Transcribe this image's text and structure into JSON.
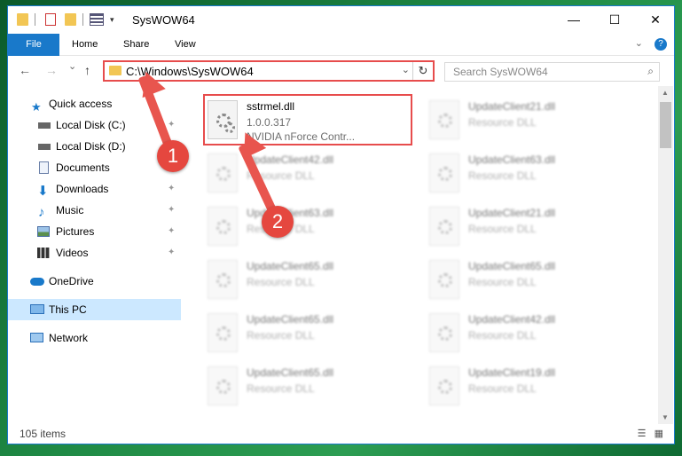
{
  "window": {
    "title": "SysWOW64",
    "minimize_glyph": "—",
    "maximize_glyph": "☐",
    "close_glyph": "✕"
  },
  "ribbon": {
    "tabs": [
      {
        "label": "File"
      },
      {
        "label": "Home"
      },
      {
        "label": "Share"
      },
      {
        "label": "View"
      }
    ],
    "help_glyph": "?"
  },
  "nav": {
    "back_glyph": "←",
    "forward_glyph": "→",
    "recent_glyph": "⌄",
    "up_glyph": "↑",
    "address": "C:\\Windows\\SysWOW64",
    "refresh_glyph": "↻",
    "search_placeholder": "Search SysWOW64"
  },
  "sidebar": {
    "items": [
      {
        "label": "Quick access",
        "icon": "star-icon",
        "pinned": false
      },
      {
        "label": "Local Disk (C:)",
        "icon": "drive-icon",
        "pinned": true
      },
      {
        "label": "Local Disk (D:)",
        "icon": "drive-icon",
        "pinned": false
      },
      {
        "label": "Documents",
        "icon": "document-icon",
        "pinned": true
      },
      {
        "label": "Downloads",
        "icon": "download-icon",
        "pinned": true
      },
      {
        "label": "Music",
        "icon": "music-icon",
        "pinned": true
      },
      {
        "label": "Pictures",
        "icon": "picture-icon",
        "pinned": true
      },
      {
        "label": "Videos",
        "icon": "video-icon",
        "pinned": true
      },
      {
        "label": "OneDrive",
        "icon": "cloud-icon",
        "pinned": false
      },
      {
        "label": "This PC",
        "icon": "computer-icon",
        "pinned": false,
        "selected": true
      },
      {
        "label": "Network",
        "icon": "network-icon",
        "pinned": false
      }
    ],
    "pin_glyph": "📌"
  },
  "files": [
    {
      "name": "sstrmel.dll",
      "line2": "1.0.0.317",
      "line3": "NVIDIA nForce Contr...",
      "highlighted": true
    },
    {
      "name": "UpdateClient21.dll",
      "line2": "Resource DLL"
    },
    {
      "name": "UpdateClient42.dll",
      "line2": "Resource DLL"
    },
    {
      "name": "UpdateClient63.dll",
      "line2": "Resource DLL"
    },
    {
      "name": "UpdateClient63.dll",
      "line2": "Resource DLL"
    },
    {
      "name": "UpdateClient21.dll",
      "line2": "Resource DLL"
    },
    {
      "name": "UpdateClient65.dll",
      "line2": "Resource DLL"
    },
    {
      "name": "UpdateClient65.dll",
      "line2": "Resource DLL"
    },
    {
      "name": "UpdateClient65.dll",
      "line2": "Resource DLL"
    },
    {
      "name": "UpdateClient42.dll",
      "line2": "Resource DLL"
    },
    {
      "name": "UpdateClient65.dll",
      "line2": "Resource DLL"
    },
    {
      "name": "UpdateClient19.dll",
      "line2": "Resource DLL"
    }
  ],
  "status": {
    "item_count": "105 items"
  },
  "annotations": {
    "badge1": "1",
    "badge2": "2"
  },
  "colors": {
    "accent": "#1979ca",
    "highlight_red": "#e74c4c",
    "selection": "#cce8ff"
  }
}
